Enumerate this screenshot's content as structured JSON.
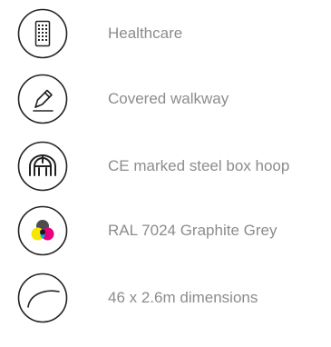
{
  "features": [
    {
      "icon": "building-icon",
      "label": "Healthcare"
    },
    {
      "icon": "pen-icon",
      "label": "Covered walkway"
    },
    {
      "icon": "steel-hoop-icon",
      "label": "CE marked steel box hoop"
    },
    {
      "icon": "colour-swatch-icon",
      "label": "RAL 7024 Graphite Grey"
    },
    {
      "icon": "arc-dimensions-icon",
      "label": "46 x 2.6m dimensions"
    }
  ],
  "colors": {
    "text": "#8c8c8c",
    "outline": "#222222",
    "swatch_yellow": "#f7e600",
    "swatch_magenta": "#e6007e",
    "swatch_cyan": "#00aeef",
    "swatch_grey": "#4b4d4f"
  }
}
